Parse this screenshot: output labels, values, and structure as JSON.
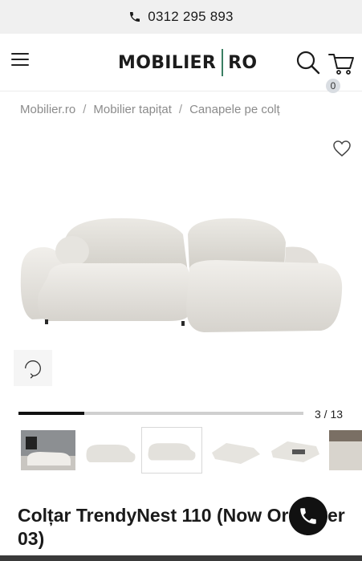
{
  "topbar": {
    "phone": "0312 295 893",
    "icon": "phone-icon"
  },
  "header": {
    "menu_icon": "hamburger-icon",
    "logo_left": "MOBILIER",
    "logo_right": "RO",
    "search_icon": "search-icon",
    "cart_icon": "cart-icon",
    "cart_count": "0"
  },
  "breadcrumb": {
    "items": [
      "Mobilier.ro",
      "Mobilier tapițat",
      "Canapele pe colț"
    ],
    "separator": "/"
  },
  "gallery": {
    "wishlist_icon": "heart-icon",
    "view360_label": "360°",
    "progress": 0.2303,
    "counter": "3 / 13",
    "thumbnails": [
      "room-photo",
      "sofa-front",
      "sofa-angle",
      "sofa-bed-open",
      "sofa-bed-unfold",
      "sofa-detail"
    ],
    "active_thumbnail": 2
  },
  "product": {
    "title": "Colțar TrendyNest 110 (Now Or Never 03)"
  },
  "colors": {
    "accent_green": "#3a7f63",
    "progress_fill": "#111111",
    "progress_track": "#cfcfcf"
  }
}
